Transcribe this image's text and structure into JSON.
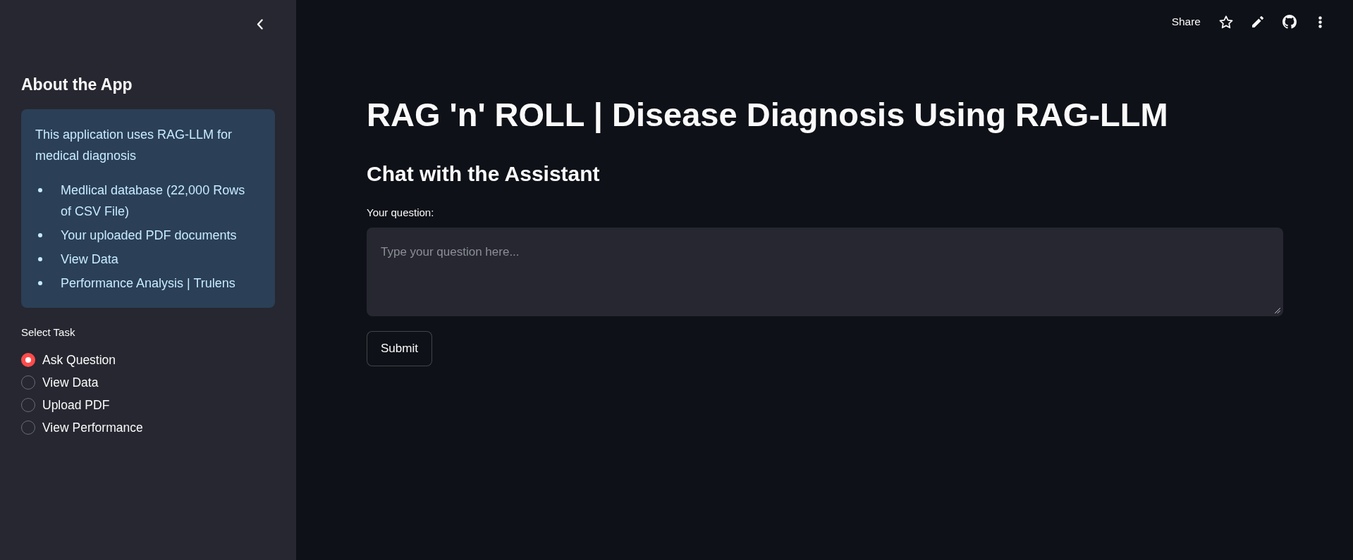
{
  "header": {
    "share_label": "Share"
  },
  "sidebar": {
    "heading": "About the App",
    "info": {
      "intro": "This application uses RAG-LLM for medical diagnosis",
      "items": [
        "Medlical database (22,000 Rows of CSV File)",
        "Your uploaded PDF documents",
        "View Data",
        "Performance Analysis | Trulens"
      ]
    },
    "task_label": "Select Task",
    "tasks": [
      {
        "label": "Ask Question",
        "selected": true
      },
      {
        "label": "View Data",
        "selected": false
      },
      {
        "label": "Upload PDF",
        "selected": false
      },
      {
        "label": "View Performance",
        "selected": false
      }
    ]
  },
  "main": {
    "title": "RAG 'n' ROLL | Disease Diagnosis Using RAG-LLM",
    "subtitle": "Chat with the Assistant",
    "question": {
      "label": "Your question:",
      "placeholder": "Type your question here..."
    },
    "submit_label": "Submit"
  }
}
